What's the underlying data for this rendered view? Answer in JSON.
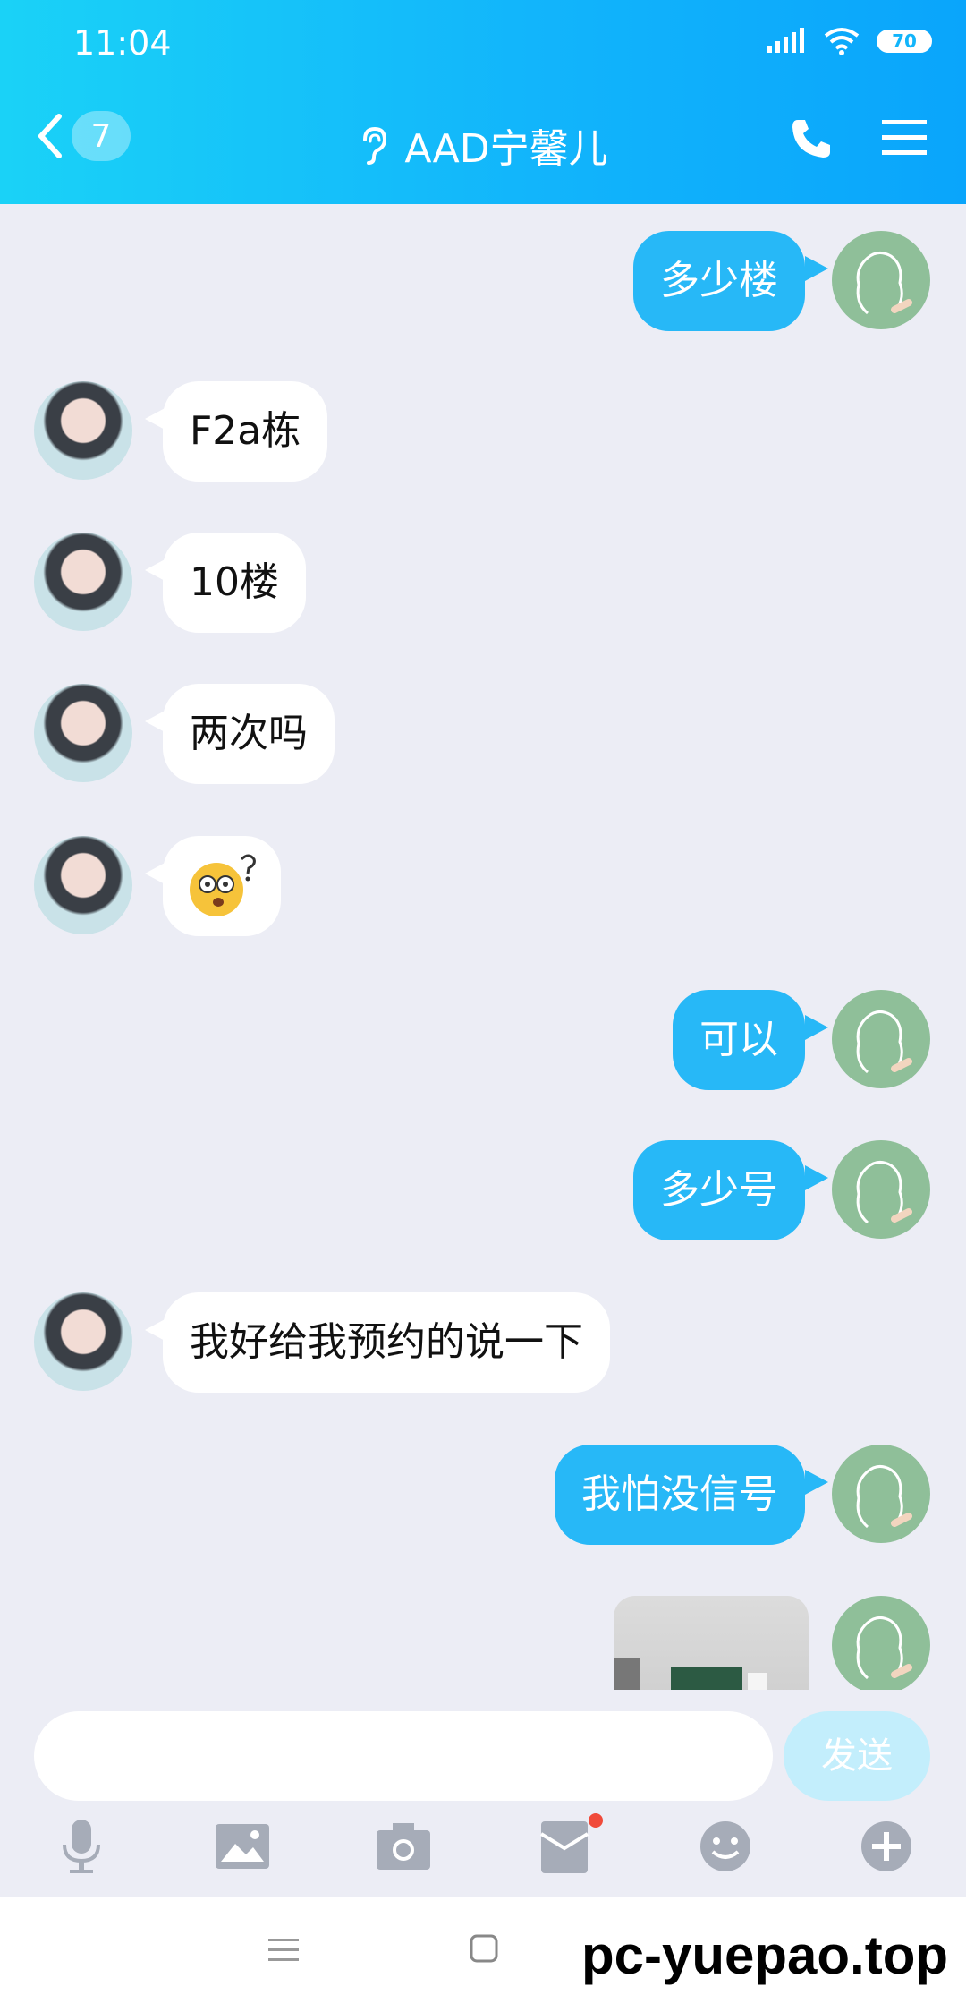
{
  "status": {
    "time": "11:04",
    "battery": "70"
  },
  "header": {
    "back_count": "7",
    "title": "AAD宁馨儿"
  },
  "messages": [
    {
      "side": "out",
      "text": "多少楼"
    },
    {
      "side": "in",
      "text": "F2a栋"
    },
    {
      "side": "in",
      "text": "10楼"
    },
    {
      "side": "in",
      "text": "两次吗"
    },
    {
      "side": "in",
      "emoji": "confused-face-emoji"
    },
    {
      "side": "out",
      "text": "可以"
    },
    {
      "side": "out",
      "text": "多少号"
    },
    {
      "side": "in",
      "text": "我好给我预约的说一下"
    },
    {
      "side": "out",
      "text": "我怕没信号"
    },
    {
      "side": "out",
      "image": "photo-thumbnail"
    }
  ],
  "input": {
    "placeholder": "",
    "send_label": "发送"
  },
  "toolbar": [
    "microphone-icon",
    "image-icon",
    "camera-icon",
    "red-packet-icon",
    "emoji-icon",
    "plus-icon"
  ],
  "watermark": "pc-yuepao.top",
  "colors": {
    "header": "#12b5fb",
    "out_bubble": "#27b8f7",
    "in_bubble": "#ffffff",
    "background": "#ecedf5",
    "send_disabled": "#c3eefc"
  }
}
